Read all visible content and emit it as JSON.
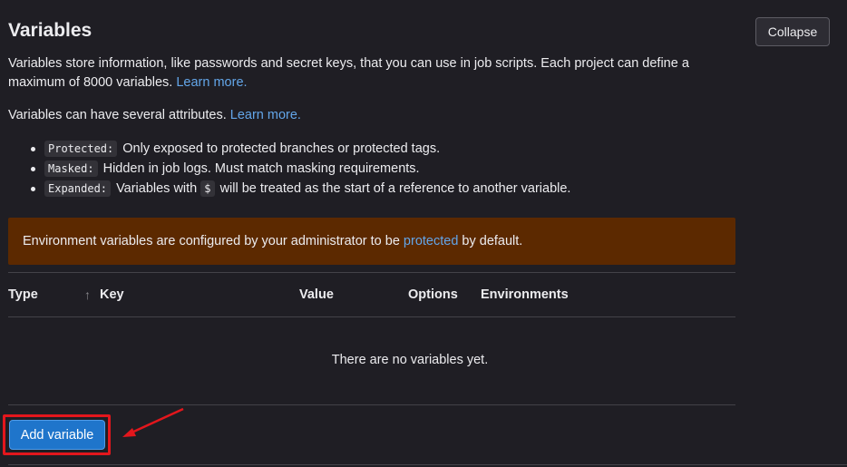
{
  "section": {
    "title": "Variables",
    "collapse_label": "Collapse",
    "description": "Variables store information, like passwords and secret keys, that you can use in job scripts. Each project can define a maximum of 8000 variables.",
    "learn_more_1": "Learn more.",
    "attributes_text": "Variables can have several attributes.",
    "learn_more_2": "Learn more."
  },
  "attributes": [
    {
      "code": "Protected:",
      "text": "Only exposed to protected branches or protected tags."
    },
    {
      "code": "Masked:",
      "text": "Hidden in job logs. Must match masking requirements."
    },
    {
      "code": "Expanded:",
      "text_before": "Variables with",
      "inline_code": "$",
      "text_after": "will be treated as the start of a reference to another variable."
    }
  ],
  "alert": {
    "text_before": "Environment variables are configured by your administrator to be",
    "link": "protected",
    "text_after": "by default.",
    "background": "#5c2900"
  },
  "table": {
    "columns": [
      "Type",
      "Key",
      "Value",
      "Options",
      "Environments"
    ],
    "sort_icon": "arrow-up-icon",
    "empty_text": "There are no variables yet."
  },
  "actions": {
    "add_variable_label": "Add variable"
  },
  "colors": {
    "background": "#1f1e24",
    "link": "#63a6e9",
    "primary_button": "#1f75cb",
    "annotation": "#e3161c"
  }
}
